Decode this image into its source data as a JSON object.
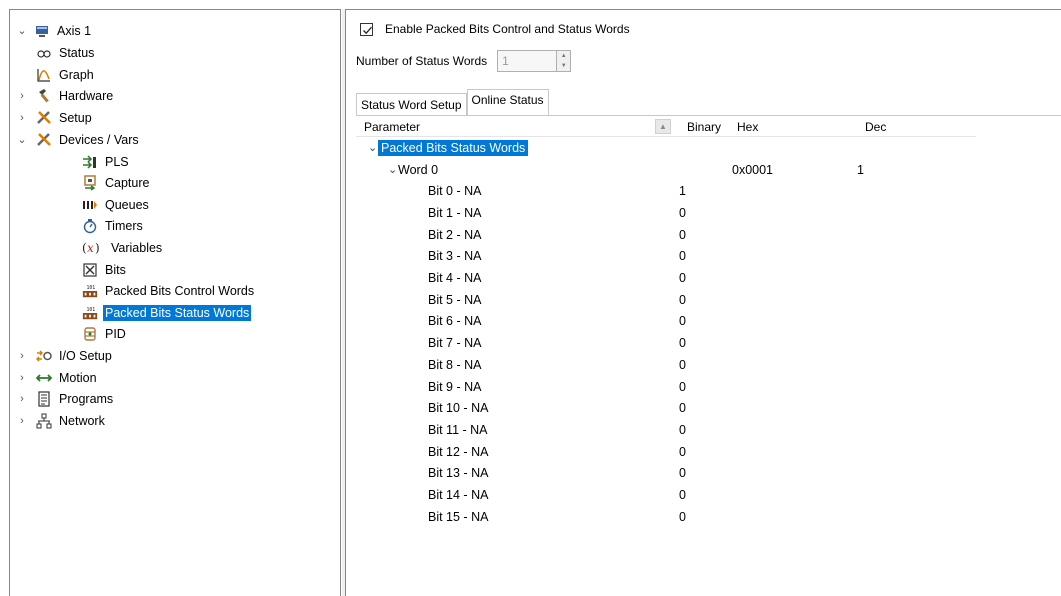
{
  "tree": [
    {
      "label": "Axis 1",
      "expander": "⌄",
      "icon": "axis-icon",
      "level": 0
    },
    {
      "label": "Status",
      "expander": "",
      "icon": "status-icon",
      "level": 1
    },
    {
      "label": "Graph",
      "expander": "",
      "icon": "graph-icon",
      "level": 1
    },
    {
      "label": "Hardware",
      "expander": "›",
      "icon": "hardware-icon",
      "level": 1
    },
    {
      "label": "Setup",
      "expander": "›",
      "icon": "setup-icon",
      "level": 1
    },
    {
      "label": "Devices / Vars",
      "expander": "⌄",
      "icon": "devices-icon",
      "level": 1
    },
    {
      "label": "PLS",
      "expander": "",
      "icon": "pls-icon",
      "level": 2
    },
    {
      "label": "Capture",
      "expander": "",
      "icon": "capture-icon",
      "level": 2
    },
    {
      "label": "Queues",
      "expander": "",
      "icon": "queues-icon",
      "level": 2
    },
    {
      "label": "Timers",
      "expander": "",
      "icon": "timer-icon",
      "level": 2
    },
    {
      "label": "Variables",
      "expander": "",
      "icon": "variables-icon",
      "level": 2
    },
    {
      "label": "Bits",
      "expander": "",
      "icon": "bits-icon",
      "level": 2
    },
    {
      "label": "Packed Bits Control Words",
      "expander": "",
      "icon": "packed-bits-icon",
      "level": 2
    },
    {
      "label": "Packed Bits Status Words",
      "expander": "",
      "icon": "packed-bits-icon",
      "level": 2,
      "selected": true
    },
    {
      "label": "PID",
      "expander": "",
      "icon": "pid-icon",
      "level": 2
    },
    {
      "label": "I/O Setup",
      "expander": "›",
      "icon": "io-icon",
      "level": 1
    },
    {
      "label": "Motion",
      "expander": "›",
      "icon": "motion-icon",
      "level": 1
    },
    {
      "label": "Programs",
      "expander": "›",
      "icon": "programs-icon",
      "level": 1
    },
    {
      "label": "Network",
      "expander": "›",
      "icon": "network-icon",
      "level": 1
    }
  ],
  "enable_checkbox": {
    "label": "Enable Packed Bits Control and Status Words",
    "checked": true
  },
  "num_status_words": {
    "label": "Number of Status Words",
    "value": "1"
  },
  "tabs": [
    {
      "label": "Status Word Setup",
      "active": false
    },
    {
      "label": "Online Status",
      "active": true
    }
  ],
  "grid": {
    "headers": {
      "parameter": "Parameter",
      "binary": "Binary",
      "hex": "Hex",
      "dec": "Dec"
    },
    "group_label": "Packed Bits Status Words",
    "word": {
      "label": "Word 0",
      "hex": "0x0001",
      "dec": "1"
    },
    "bits": [
      {
        "label": "Bit 0 - NA",
        "binary": "1"
      },
      {
        "label": "Bit 1 - NA",
        "binary": "0"
      },
      {
        "label": "Bit 2 - NA",
        "binary": "0"
      },
      {
        "label": "Bit 3 - NA",
        "binary": "0"
      },
      {
        "label": "Bit 4 - NA",
        "binary": "0"
      },
      {
        "label": "Bit 5 - NA",
        "binary": "0"
      },
      {
        "label": "Bit 6 - NA",
        "binary": "0"
      },
      {
        "label": "Bit 7 - NA",
        "binary": "0"
      },
      {
        "label": "Bit 8 - NA",
        "binary": "0"
      },
      {
        "label": "Bit 9 - NA",
        "binary": "0"
      },
      {
        "label": "Bit 10 - NA",
        "binary": "0"
      },
      {
        "label": "Bit 11 - NA",
        "binary": "0"
      },
      {
        "label": "Bit 12 - NA",
        "binary": "0"
      },
      {
        "label": "Bit 13 - NA",
        "binary": "0"
      },
      {
        "label": "Bit 14 - NA",
        "binary": "0"
      },
      {
        "label": "Bit 15 - NA",
        "binary": "0"
      }
    ]
  },
  "colors": {
    "selection": "#0078d7",
    "border": "#828790"
  }
}
